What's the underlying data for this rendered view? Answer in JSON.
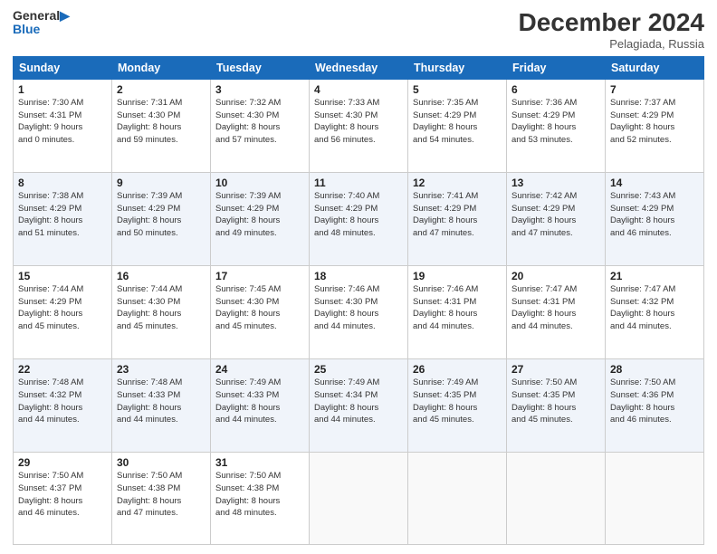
{
  "header": {
    "logo_line1": "General",
    "logo_line2": "Blue",
    "month_title": "December 2024",
    "location": "Pelagiada, Russia"
  },
  "days_of_week": [
    "Sunday",
    "Monday",
    "Tuesday",
    "Wednesday",
    "Thursday",
    "Friday",
    "Saturday"
  ],
  "weeks": [
    [
      {
        "day": "1",
        "info": "Sunrise: 7:30 AM\nSunset: 4:31 PM\nDaylight: 9 hours\nand 0 minutes."
      },
      {
        "day": "2",
        "info": "Sunrise: 7:31 AM\nSunset: 4:30 PM\nDaylight: 8 hours\nand 59 minutes."
      },
      {
        "day": "3",
        "info": "Sunrise: 7:32 AM\nSunset: 4:30 PM\nDaylight: 8 hours\nand 57 minutes."
      },
      {
        "day": "4",
        "info": "Sunrise: 7:33 AM\nSunset: 4:30 PM\nDaylight: 8 hours\nand 56 minutes."
      },
      {
        "day": "5",
        "info": "Sunrise: 7:35 AM\nSunset: 4:29 PM\nDaylight: 8 hours\nand 54 minutes."
      },
      {
        "day": "6",
        "info": "Sunrise: 7:36 AM\nSunset: 4:29 PM\nDaylight: 8 hours\nand 53 minutes."
      },
      {
        "day": "7",
        "info": "Sunrise: 7:37 AM\nSunset: 4:29 PM\nDaylight: 8 hours\nand 52 minutes."
      }
    ],
    [
      {
        "day": "8",
        "info": "Sunrise: 7:38 AM\nSunset: 4:29 PM\nDaylight: 8 hours\nand 51 minutes."
      },
      {
        "day": "9",
        "info": "Sunrise: 7:39 AM\nSunset: 4:29 PM\nDaylight: 8 hours\nand 50 minutes."
      },
      {
        "day": "10",
        "info": "Sunrise: 7:39 AM\nSunset: 4:29 PM\nDaylight: 8 hours\nand 49 minutes."
      },
      {
        "day": "11",
        "info": "Sunrise: 7:40 AM\nSunset: 4:29 PM\nDaylight: 8 hours\nand 48 minutes."
      },
      {
        "day": "12",
        "info": "Sunrise: 7:41 AM\nSunset: 4:29 PM\nDaylight: 8 hours\nand 47 minutes."
      },
      {
        "day": "13",
        "info": "Sunrise: 7:42 AM\nSunset: 4:29 PM\nDaylight: 8 hours\nand 47 minutes."
      },
      {
        "day": "14",
        "info": "Sunrise: 7:43 AM\nSunset: 4:29 PM\nDaylight: 8 hours\nand 46 minutes."
      }
    ],
    [
      {
        "day": "15",
        "info": "Sunrise: 7:44 AM\nSunset: 4:29 PM\nDaylight: 8 hours\nand 45 minutes."
      },
      {
        "day": "16",
        "info": "Sunrise: 7:44 AM\nSunset: 4:30 PM\nDaylight: 8 hours\nand 45 minutes."
      },
      {
        "day": "17",
        "info": "Sunrise: 7:45 AM\nSunset: 4:30 PM\nDaylight: 8 hours\nand 45 minutes."
      },
      {
        "day": "18",
        "info": "Sunrise: 7:46 AM\nSunset: 4:30 PM\nDaylight: 8 hours\nand 44 minutes."
      },
      {
        "day": "19",
        "info": "Sunrise: 7:46 AM\nSunset: 4:31 PM\nDaylight: 8 hours\nand 44 minutes."
      },
      {
        "day": "20",
        "info": "Sunrise: 7:47 AM\nSunset: 4:31 PM\nDaylight: 8 hours\nand 44 minutes."
      },
      {
        "day": "21",
        "info": "Sunrise: 7:47 AM\nSunset: 4:32 PM\nDaylight: 8 hours\nand 44 minutes."
      }
    ],
    [
      {
        "day": "22",
        "info": "Sunrise: 7:48 AM\nSunset: 4:32 PM\nDaylight: 8 hours\nand 44 minutes."
      },
      {
        "day": "23",
        "info": "Sunrise: 7:48 AM\nSunset: 4:33 PM\nDaylight: 8 hours\nand 44 minutes."
      },
      {
        "day": "24",
        "info": "Sunrise: 7:49 AM\nSunset: 4:33 PM\nDaylight: 8 hours\nand 44 minutes."
      },
      {
        "day": "25",
        "info": "Sunrise: 7:49 AM\nSunset: 4:34 PM\nDaylight: 8 hours\nand 44 minutes."
      },
      {
        "day": "26",
        "info": "Sunrise: 7:49 AM\nSunset: 4:35 PM\nDaylight: 8 hours\nand 45 minutes."
      },
      {
        "day": "27",
        "info": "Sunrise: 7:50 AM\nSunset: 4:35 PM\nDaylight: 8 hours\nand 45 minutes."
      },
      {
        "day": "28",
        "info": "Sunrise: 7:50 AM\nSunset: 4:36 PM\nDaylight: 8 hours\nand 46 minutes."
      }
    ],
    [
      {
        "day": "29",
        "info": "Sunrise: 7:50 AM\nSunset: 4:37 PM\nDaylight: 8 hours\nand 46 minutes."
      },
      {
        "day": "30",
        "info": "Sunrise: 7:50 AM\nSunset: 4:38 PM\nDaylight: 8 hours\nand 47 minutes."
      },
      {
        "day": "31",
        "info": "Sunrise: 7:50 AM\nSunset: 4:38 PM\nDaylight: 8 hours\nand 48 minutes."
      },
      null,
      null,
      null,
      null
    ]
  ]
}
